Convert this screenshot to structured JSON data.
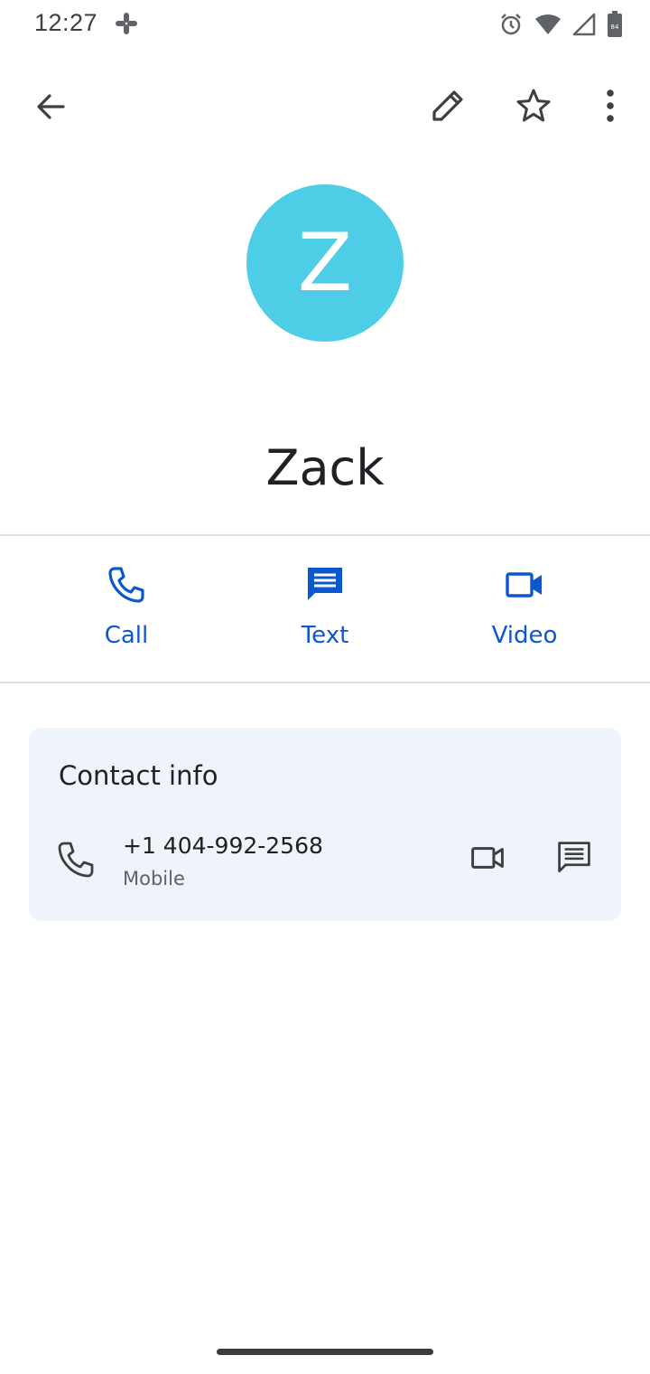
{
  "status_bar": {
    "time": "12:27",
    "notification_icons": [
      "slack-icon"
    ],
    "system_icons": [
      "alarm-icon",
      "wifi-icon",
      "signal-icon",
      "battery-icon"
    ],
    "battery_level": "84"
  },
  "app_bar": {
    "icons": [
      "back-arrow-icon",
      "edit-pencil-icon",
      "star-outline-icon",
      "more-vert-icon"
    ]
  },
  "contact": {
    "avatar_letter": "Z",
    "avatar_color": "#4ecde6",
    "name": "Zack"
  },
  "actions": [
    {
      "label": "Call",
      "icon": "phone-icon"
    },
    {
      "label": "Text",
      "icon": "message-icon"
    },
    {
      "label": "Video",
      "icon": "videocam-icon"
    }
  ],
  "contact_info": {
    "title": "Contact info",
    "phone_number": "+1 404-992-2568",
    "phone_type": "Mobile"
  },
  "colors": {
    "accent": "#0b57d0",
    "card_background": "#eff3fa",
    "icon_dark": "#3c4043"
  }
}
